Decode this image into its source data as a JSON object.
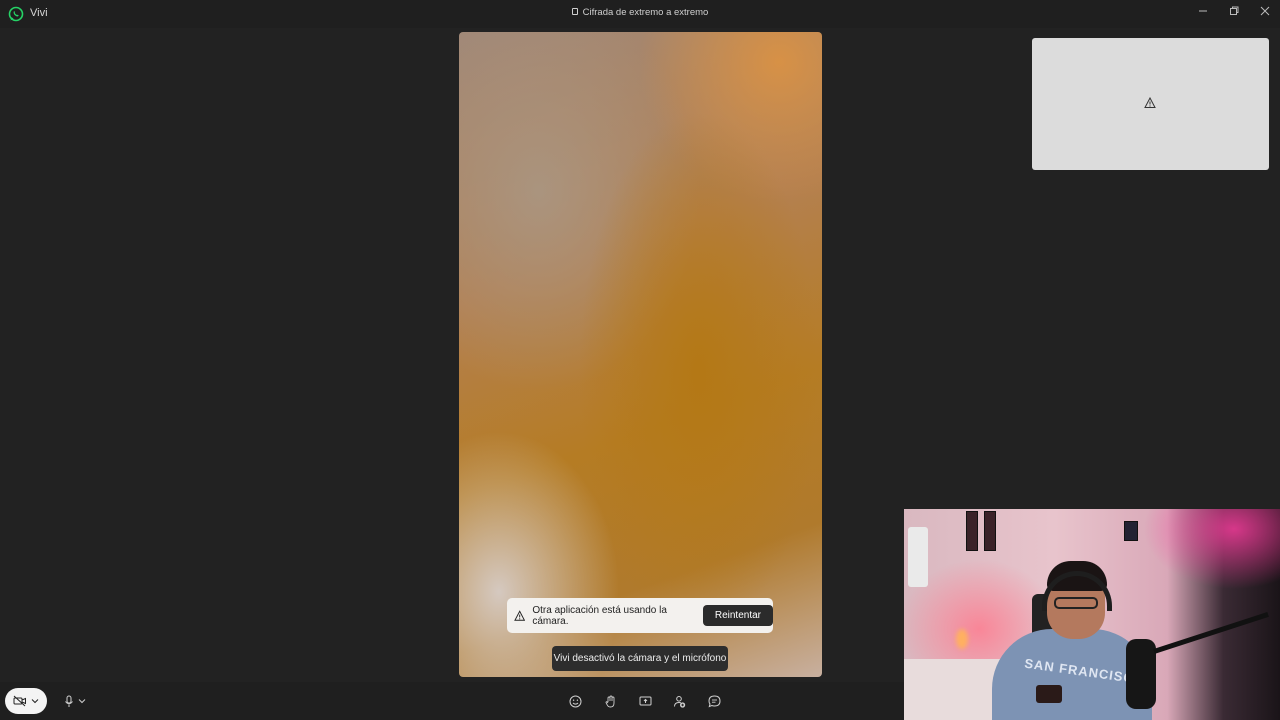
{
  "window": {
    "app_title": "Vivi",
    "e2e_label": "Cifrada de extremo a extremo",
    "icons": [
      "whatsapp-icon",
      "lock-icon",
      "minimize-icon",
      "restore-icon",
      "close-icon"
    ]
  },
  "call": {
    "camera_banner": {
      "message": "Otra aplicación está usando la cámara.",
      "retry_label": "Reintentar",
      "icon": "warning-icon"
    },
    "status_toast": "Vivi desactivó la cámara y el micrófono",
    "self_preview_icon": "warning-icon"
  },
  "controls": {
    "camera": {
      "icon": "camera-off-icon",
      "state": "off"
    },
    "mic": {
      "icon": "microphone-icon"
    },
    "toolbar_icons": [
      "emoji-icon",
      "raise-hand-icon",
      "share-screen-icon",
      "add-participant-icon",
      "chat-icon"
    ]
  },
  "colors": {
    "background": "#202020",
    "banner": "#f3f1ee",
    "accent_whatsapp": "#25d366"
  }
}
